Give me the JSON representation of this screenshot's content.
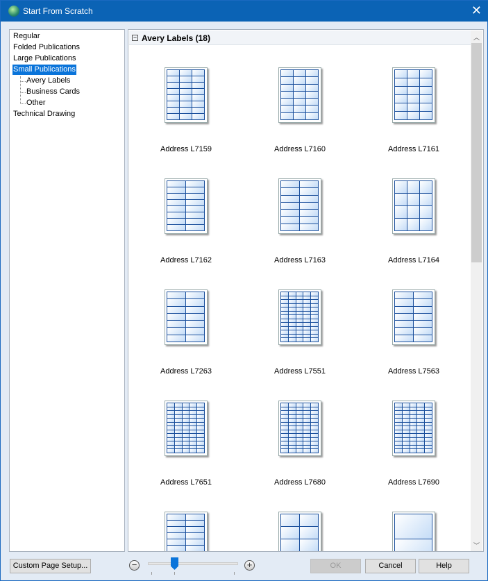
{
  "window": {
    "title": "Start From Scratch",
    "close": "✕"
  },
  "tree": {
    "items": [
      "Regular",
      "Folded Publications",
      "Large Publications",
      "Small Publications",
      "Avery Labels",
      "Business Cards",
      "Other",
      "Technical Drawing"
    ],
    "selected": "Small Publications"
  },
  "gallery": {
    "group_title": "Avery Labels (18)",
    "collapse": "−",
    "items": [
      "Address L7159",
      "Address L7160",
      "Address L7161",
      "Address L7162",
      "Address L7163",
      "Address L7164",
      "Address L7263",
      "Address L7551",
      "Address L7563",
      "Address L7651",
      "Address L7680",
      "Address L7690",
      "",
      "",
      ""
    ]
  },
  "footer": {
    "custom_page_setup": "Custom Page Setup...",
    "zoom_out": "−",
    "zoom_in": "+",
    "zoom_level": 0.3,
    "ok": "OK",
    "cancel": "Cancel",
    "help": "Help"
  },
  "colors": {
    "titlebar": "#0b63b5",
    "selection": "#0a74da"
  }
}
